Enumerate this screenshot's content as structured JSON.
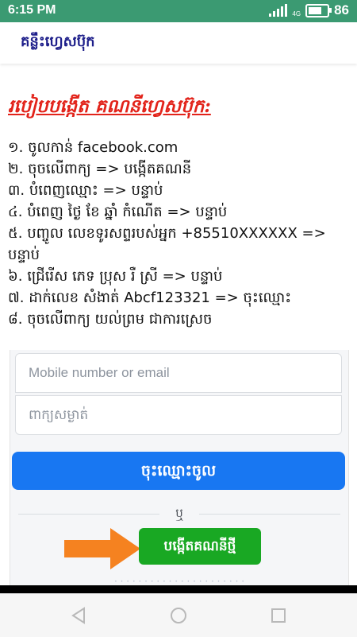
{
  "status_bar": {
    "time": "6:15 PM",
    "network": "4G",
    "battery": "86",
    "battery_level_percent": 86
  },
  "app_bar": {
    "title": "គន្លឹះហ្វេសប៊ុក"
  },
  "article": {
    "heading": "របៀបបង្កើត គណនីហ្វេសប៊ុក:",
    "steps": [
      "១. ចូលកាន់ facebook.com",
      "២. ចុចលើពាក្យ  => បង្កើតគណនី",
      "៣. បំពេញឈ្មោះ => បន្ទាប់",
      "៤. បំពេញ ថ្ងៃ ខែ ឆ្នាំ កំណើត => បន្ទាប់",
      "៥. បញ្ចូល លេខទូរសព្ទរបស់អ្នក +85510XXXXXX  =>",
      "បន្ទាប់",
      "៦. ជ្រើរើស ភេទ ប្រុស រឺ ស្រី => បន្ទាប់",
      "៧. ដាក់លេខ សំងាត់ Abcf123321 => ចុះឈ្មោះ",
      "៨. ចុចលើពាក្យ យល់ព្រម ជាការស្រេច"
    ]
  },
  "facebook_login": {
    "email_placeholder": "Mobile number or email",
    "password_placeholder": "ពាក្យសម្ងាត់",
    "login_button": "ចុះឈ្មោះចូល",
    "or_text": "ឬ",
    "create_account_button": "បង្កើតគណនីថ្មី",
    "colors": {
      "login_blue": "#1877f2",
      "create_green": "#19a823",
      "arrow_orange": "#f58220"
    }
  },
  "nav_bar": {
    "back": "back-icon",
    "home": "home-icon",
    "recent": "recent-apps-icon"
  }
}
